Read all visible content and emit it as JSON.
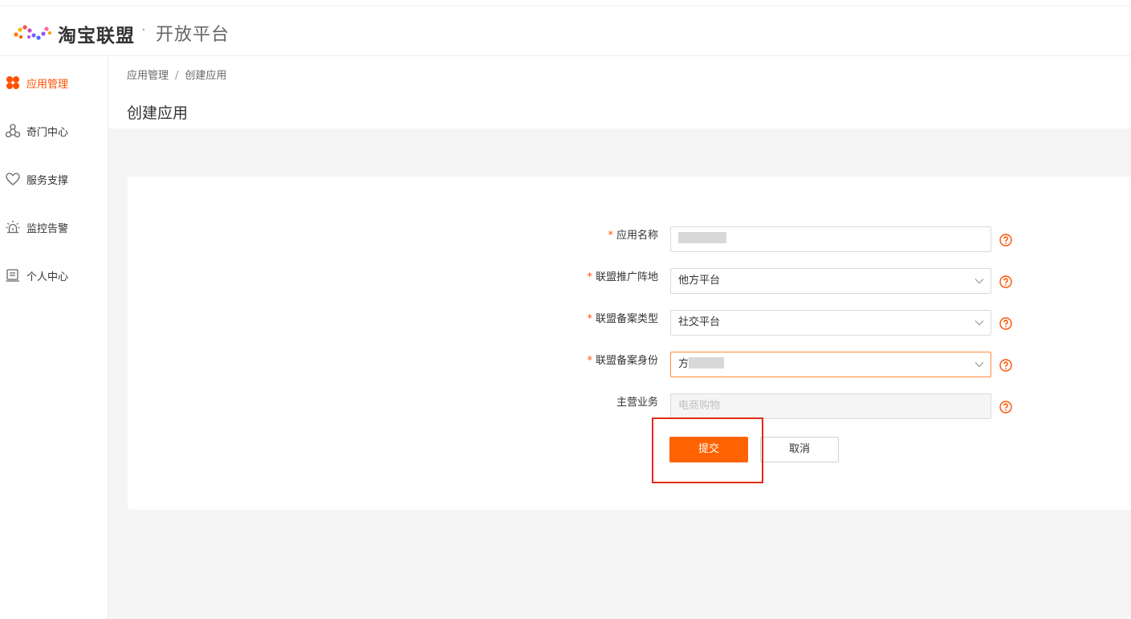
{
  "header": {
    "brand": "淘宝联盟",
    "separator": "·",
    "subtitle": "开放平台"
  },
  "sidebar": {
    "items": [
      {
        "label": "应用管理",
        "icon": "grid-flower-icon",
        "active": true
      },
      {
        "label": "奇门中心",
        "icon": "network-nodes-icon",
        "active": false
      },
      {
        "label": "服务支撑",
        "icon": "heart-icon",
        "active": false
      },
      {
        "label": "监控告警",
        "icon": "alarm-light-icon",
        "active": false
      },
      {
        "label": "个人中心",
        "icon": "profile-card-icon",
        "active": false
      }
    ]
  },
  "breadcrumb": {
    "parent": "应用管理",
    "separator": "/",
    "current": "创建应用"
  },
  "page": {
    "title": "创建应用"
  },
  "form": {
    "required_mark": "*",
    "app_name": {
      "label": "应用名称",
      "value": ""
    },
    "promo_position": {
      "label": "联盟推广阵地",
      "value": "他方平台"
    },
    "filing_type": {
      "label": "联盟备案类型",
      "value": "社交平台"
    },
    "filing_identity": {
      "label": "联盟备案身份",
      "value": "方"
    },
    "main_business": {
      "label": "主营业务",
      "placeholder": "电商购物"
    },
    "submit_label": "提交",
    "cancel_label": "取消"
  },
  "colors": {
    "accent": "#ff6200",
    "required": "#ff5000",
    "highlight_box": "#e22a1a"
  }
}
